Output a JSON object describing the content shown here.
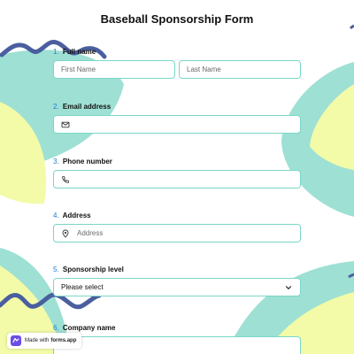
{
  "form": {
    "title": "Baseball Sponsorship Form",
    "fields": [
      {
        "number": "1.",
        "label": "Full name",
        "first_placeholder": "First Name",
        "last_placeholder": "Last Name"
      },
      {
        "number": "2.",
        "label": "Email address",
        "icon": "envelope-icon"
      },
      {
        "number": "3.",
        "label": "Phone number",
        "icon": "phone-icon"
      },
      {
        "number": "4.",
        "label": "Address",
        "icon": "location-pin-icon",
        "placeholder": "Address"
      },
      {
        "number": "5.",
        "label": "Sponsorship level",
        "selected": "Please select",
        "icon": "chevron-down-icon"
      },
      {
        "number": "6.",
        "label": "Company name"
      }
    ]
  },
  "badge": {
    "prefix": "Made with",
    "brand": "forms.app"
  },
  "colors": {
    "teal": "#9ee0d4",
    "yellow": "#f3fba8",
    "navy": "#4a5f9e",
    "border": "#7ad7c7",
    "number": "#1a7cd6"
  }
}
